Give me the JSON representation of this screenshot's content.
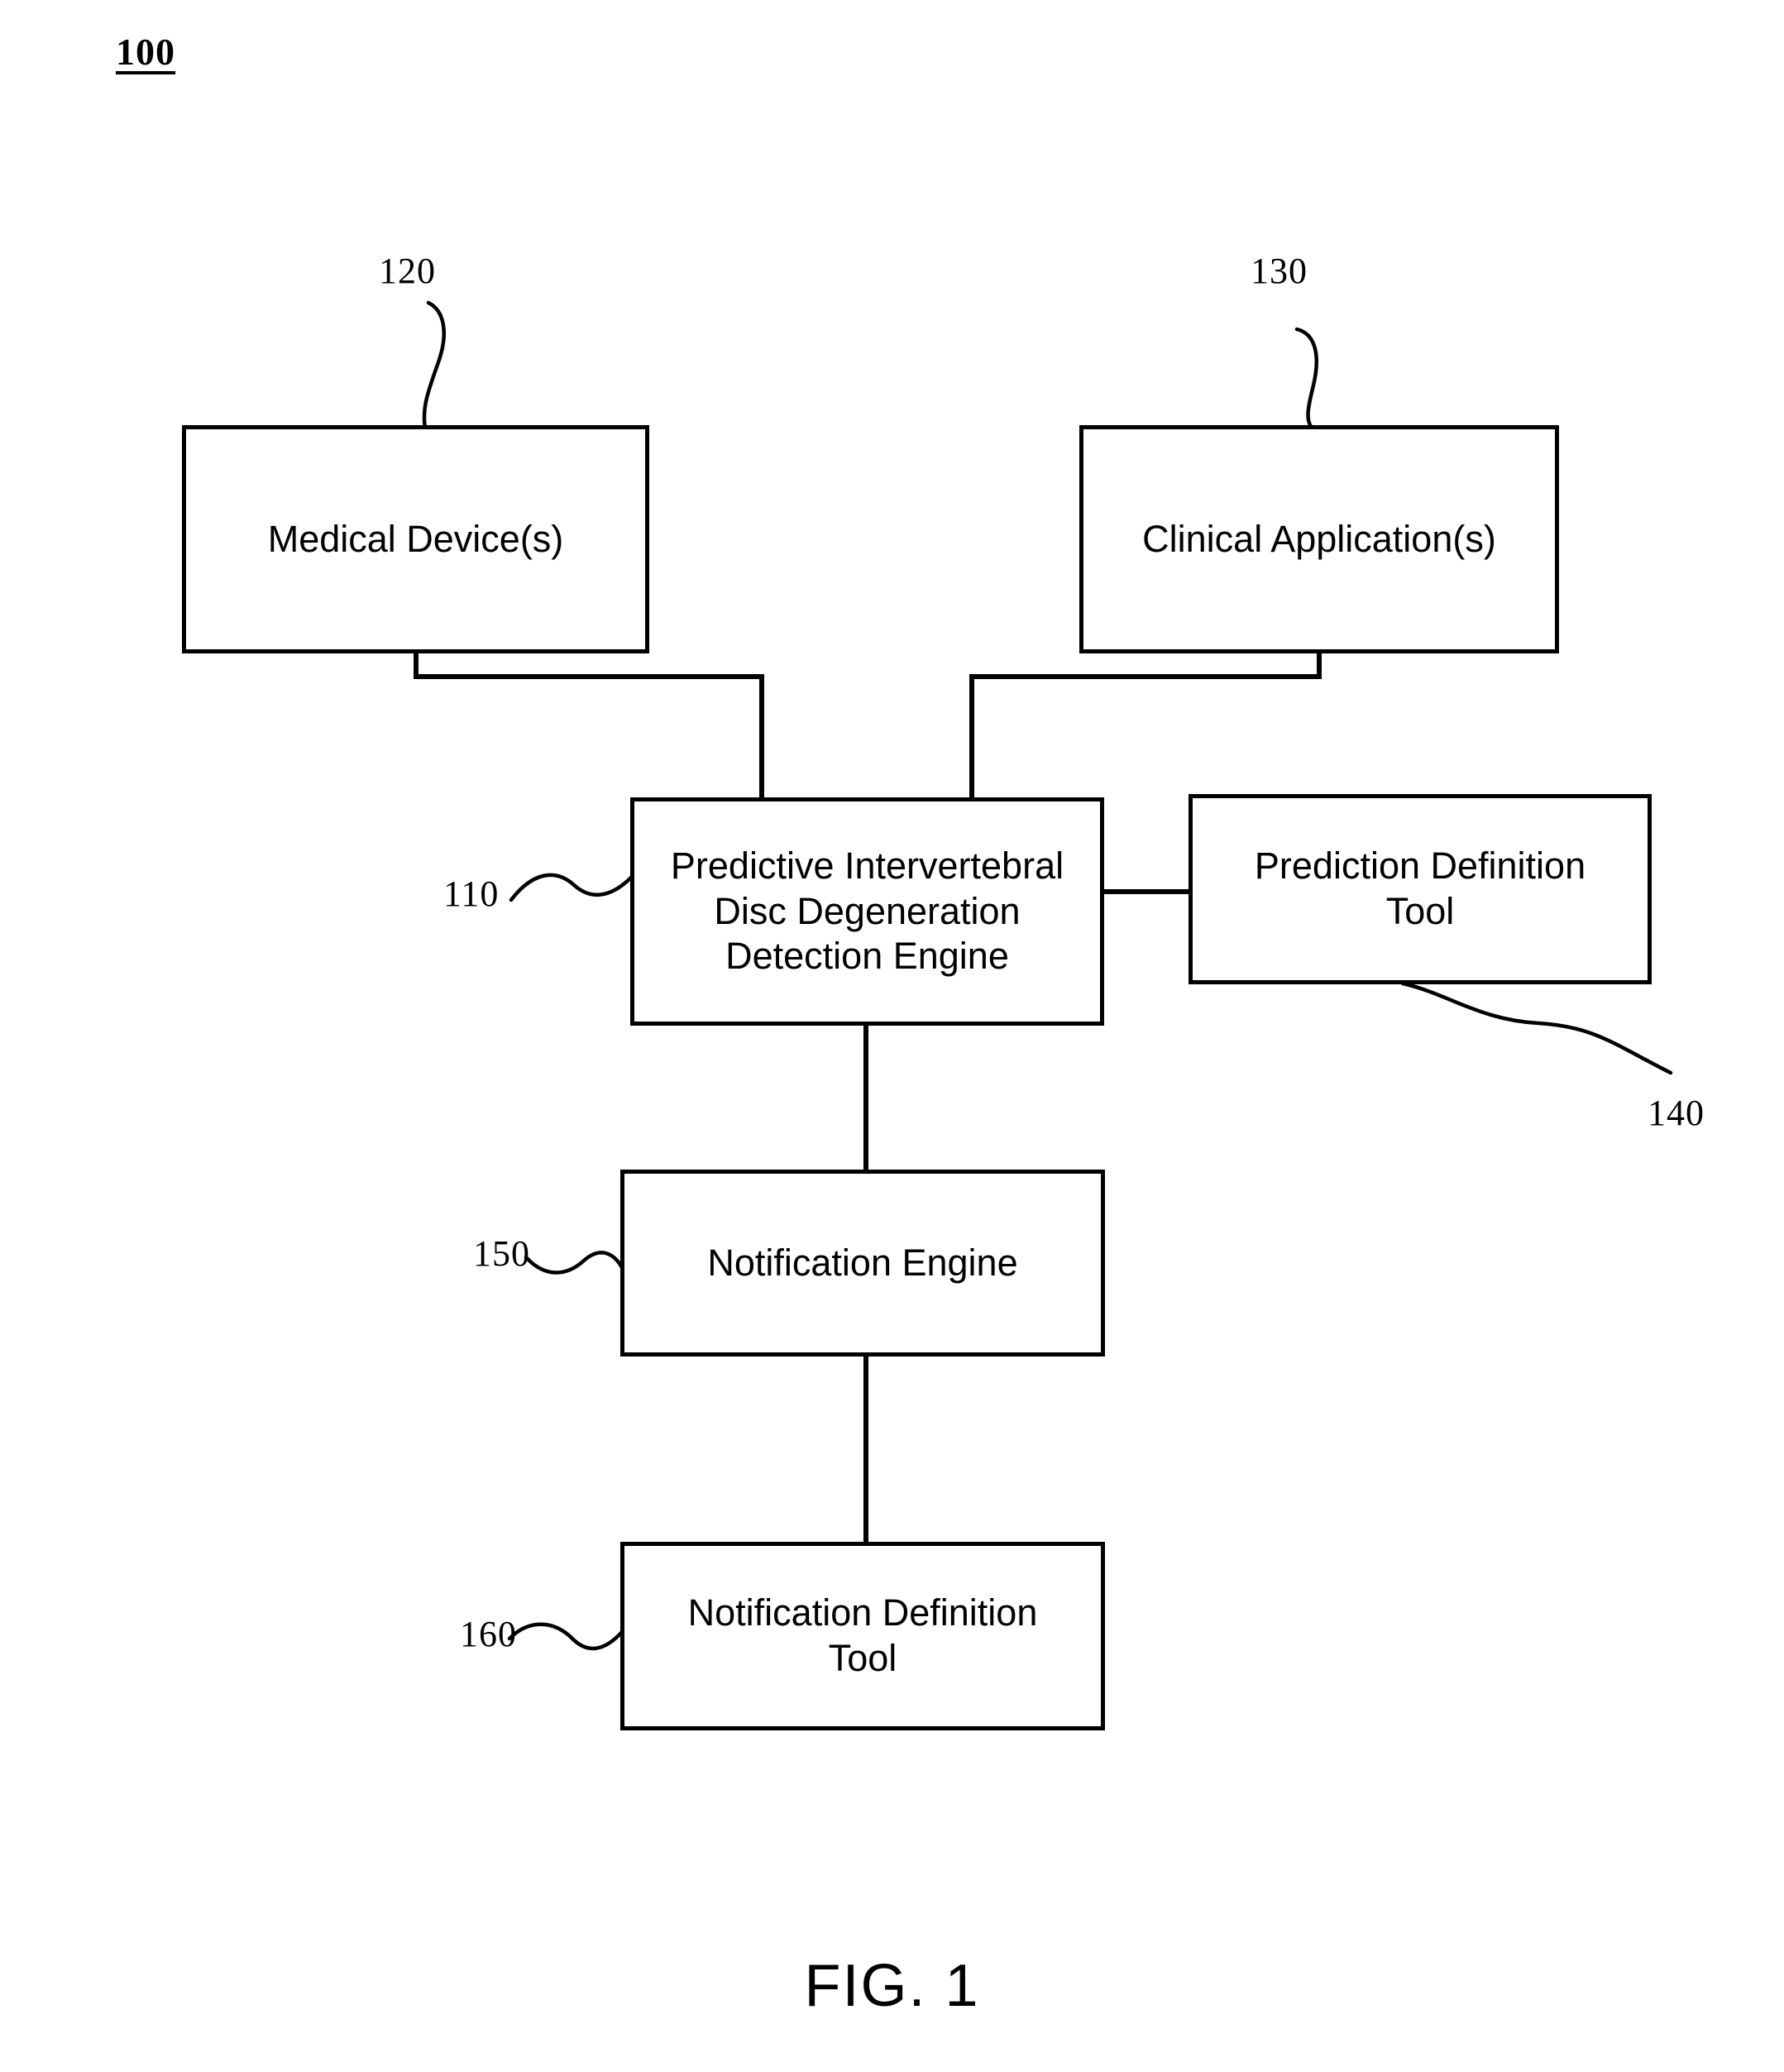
{
  "figure": {
    "id_label": "100",
    "caption": "FIG. 1"
  },
  "nodes": {
    "medical_devices": {
      "label": "Medical Device(s)",
      "ref": "120"
    },
    "clinical_applications": {
      "label": "Clinical Application(s)",
      "ref": "130"
    },
    "detection_engine": {
      "label": "Predictive Intervertebral\nDisc Degeneration\nDetection Engine",
      "ref": "110"
    },
    "prediction_definition_tool": {
      "label": "Prediction Definition\nTool",
      "ref": "140"
    },
    "notification_engine": {
      "label": "Notification Engine",
      "ref": "150"
    },
    "notification_definition_tool": {
      "label": "Notification Definition\nTool",
      "ref": "160"
    }
  },
  "colors": {
    "stroke": "#000000",
    "background": "#ffffff"
  }
}
